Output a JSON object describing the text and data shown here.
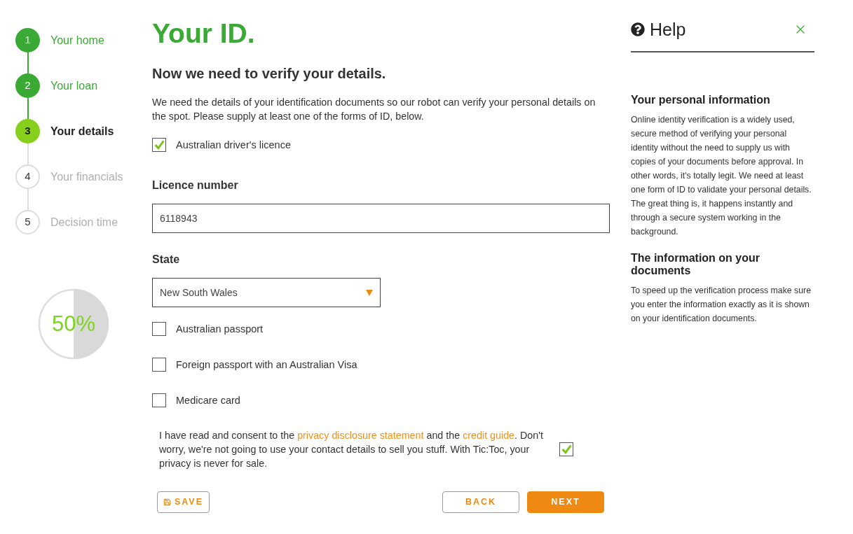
{
  "steps": [
    {
      "number": "1",
      "label": "Your home",
      "done": true,
      "current": false
    },
    {
      "number": "2",
      "label": "Your loan",
      "done": true,
      "current": false
    },
    {
      "number": "3",
      "label": "Your details",
      "done": false,
      "current": true
    },
    {
      "number": "4",
      "label": "Your financials",
      "done": false,
      "current": false
    },
    {
      "number": "5",
      "label": "Decision time",
      "done": false,
      "current": false
    }
  ],
  "progress": {
    "label": "50%",
    "level": 0.5
  },
  "page_title": "Your ID.",
  "subtitle": "Now we need to verify your details.",
  "intro": "We need the details of your identification documents so our robot can verify your personal details on the spot. Please supply at least one of the forms of ID, below.",
  "id_options": [
    {
      "kind": "checkbox",
      "label": "Australian driver's licence",
      "checked": true
    },
    {
      "kind": "text_field",
      "label": "Licence number",
      "value": "6118943"
    },
    {
      "kind": "select",
      "label": "State",
      "value": "New South Wales"
    },
    {
      "kind": "checkbox",
      "label": "Australian passport",
      "checked": false
    },
    {
      "kind": "checkbox",
      "label": "Foreign passport with an Australian Visa",
      "checked": false
    },
    {
      "kind": "checkbox",
      "label": "Medicare card",
      "checked": false
    }
  ],
  "consent": {
    "parts": [
      {
        "kind": "text",
        "text": "I have read and consent to the "
      },
      {
        "kind": "link",
        "text": "privacy disclosure statement"
      },
      {
        "kind": "text",
        "text": " and the "
      },
      {
        "kind": "link",
        "text": "credit guide"
      },
      {
        "kind": "text",
        "text": ". Don't worry, we're not going to use your contact details to sell you stuff. With Tic:Toc, your privacy is never for sale."
      }
    ],
    "checked": true
  },
  "buttons": [
    {
      "kind": "save",
      "label": "SAVE"
    },
    {
      "kind": "back",
      "label": "BACK"
    },
    {
      "kind": "next",
      "label": "NEXT"
    }
  ],
  "help": {
    "title": "Help",
    "sections": [
      {
        "heading": "Your personal information",
        "body": "Online identity verification is a widely used, secure method of verifying your personal identity without the need to supply us with copies of your documents before approval. In other words, it's totally legit. We need at least one form of ID to validate your personal details. The great thing is, it happens instantly and through a secure system working in the background."
      },
      {
        "heading": "The information on your documents",
        "body": "To speed up the verification process make sure you enter the information exactly as it is shown on your identification documents."
      }
    ]
  }
}
